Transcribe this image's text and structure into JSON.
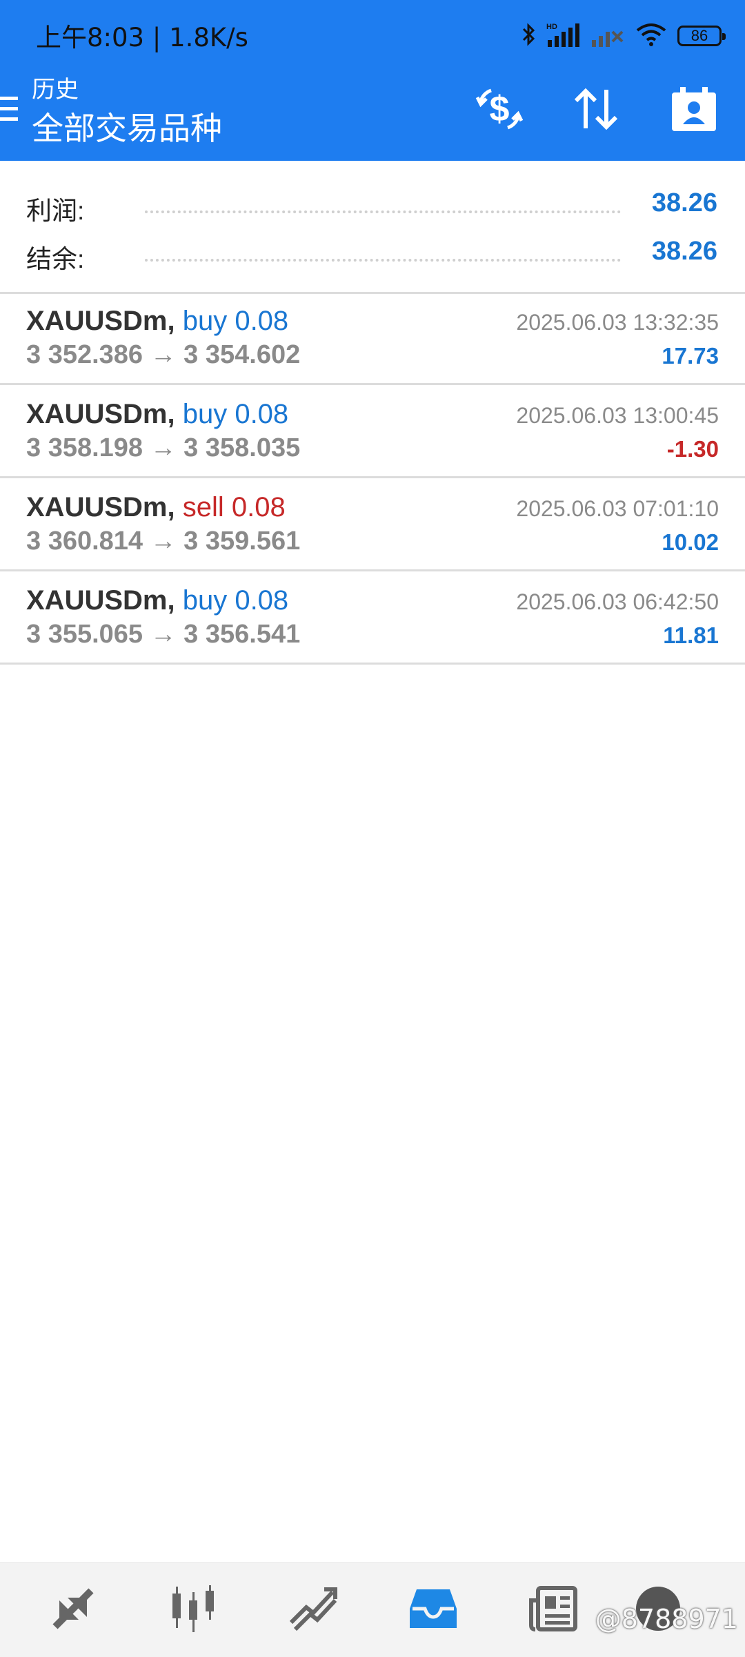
{
  "status_bar": {
    "time": "上午8:03 | 1.8K/s",
    "battery": "86"
  },
  "header": {
    "subtitle": "历史",
    "title": "全部交易品种"
  },
  "summary": {
    "profit_label": "利润:",
    "profit_value": "38.26",
    "balance_label": "结余:",
    "balance_value": "38.26"
  },
  "trades": [
    {
      "symbol": "XAUUSDm,",
      "side": "buy 0.08",
      "prices": "3 352.386 → 3 354.602",
      "time": "2025.06.03 13:32:35",
      "profit": "17.73"
    },
    {
      "symbol": "XAUUSDm,",
      "side": "buy 0.08",
      "prices": "3 358.198 → 3 358.035",
      "time": "2025.06.03 13:00:45",
      "profit": "-1.30"
    },
    {
      "symbol": "XAUUSDm,",
      "side": "sell 0.08",
      "prices": "3 360.814 → 3 359.561",
      "time": "2025.06.03 07:01:10",
      "profit": "10.02"
    },
    {
      "symbol": "XAUUSDm,",
      "side": "buy 0.08",
      "prices": "3 355.065 → 3 356.541",
      "time": "2025.06.03 06:42:50",
      "profit": "11.81"
    }
  ],
  "colors": {
    "header_bg": "#1e7df0",
    "accent": "#1976d2",
    "loss": "#c62828",
    "nav_active": "#1e88e5"
  },
  "bottom_nav": {
    "items": [
      "quotes-icon",
      "chart-icon",
      "trade-icon",
      "history-icon",
      "news-icon",
      "chat-icon"
    ],
    "active": "history-icon"
  },
  "watermark": "@8788971"
}
